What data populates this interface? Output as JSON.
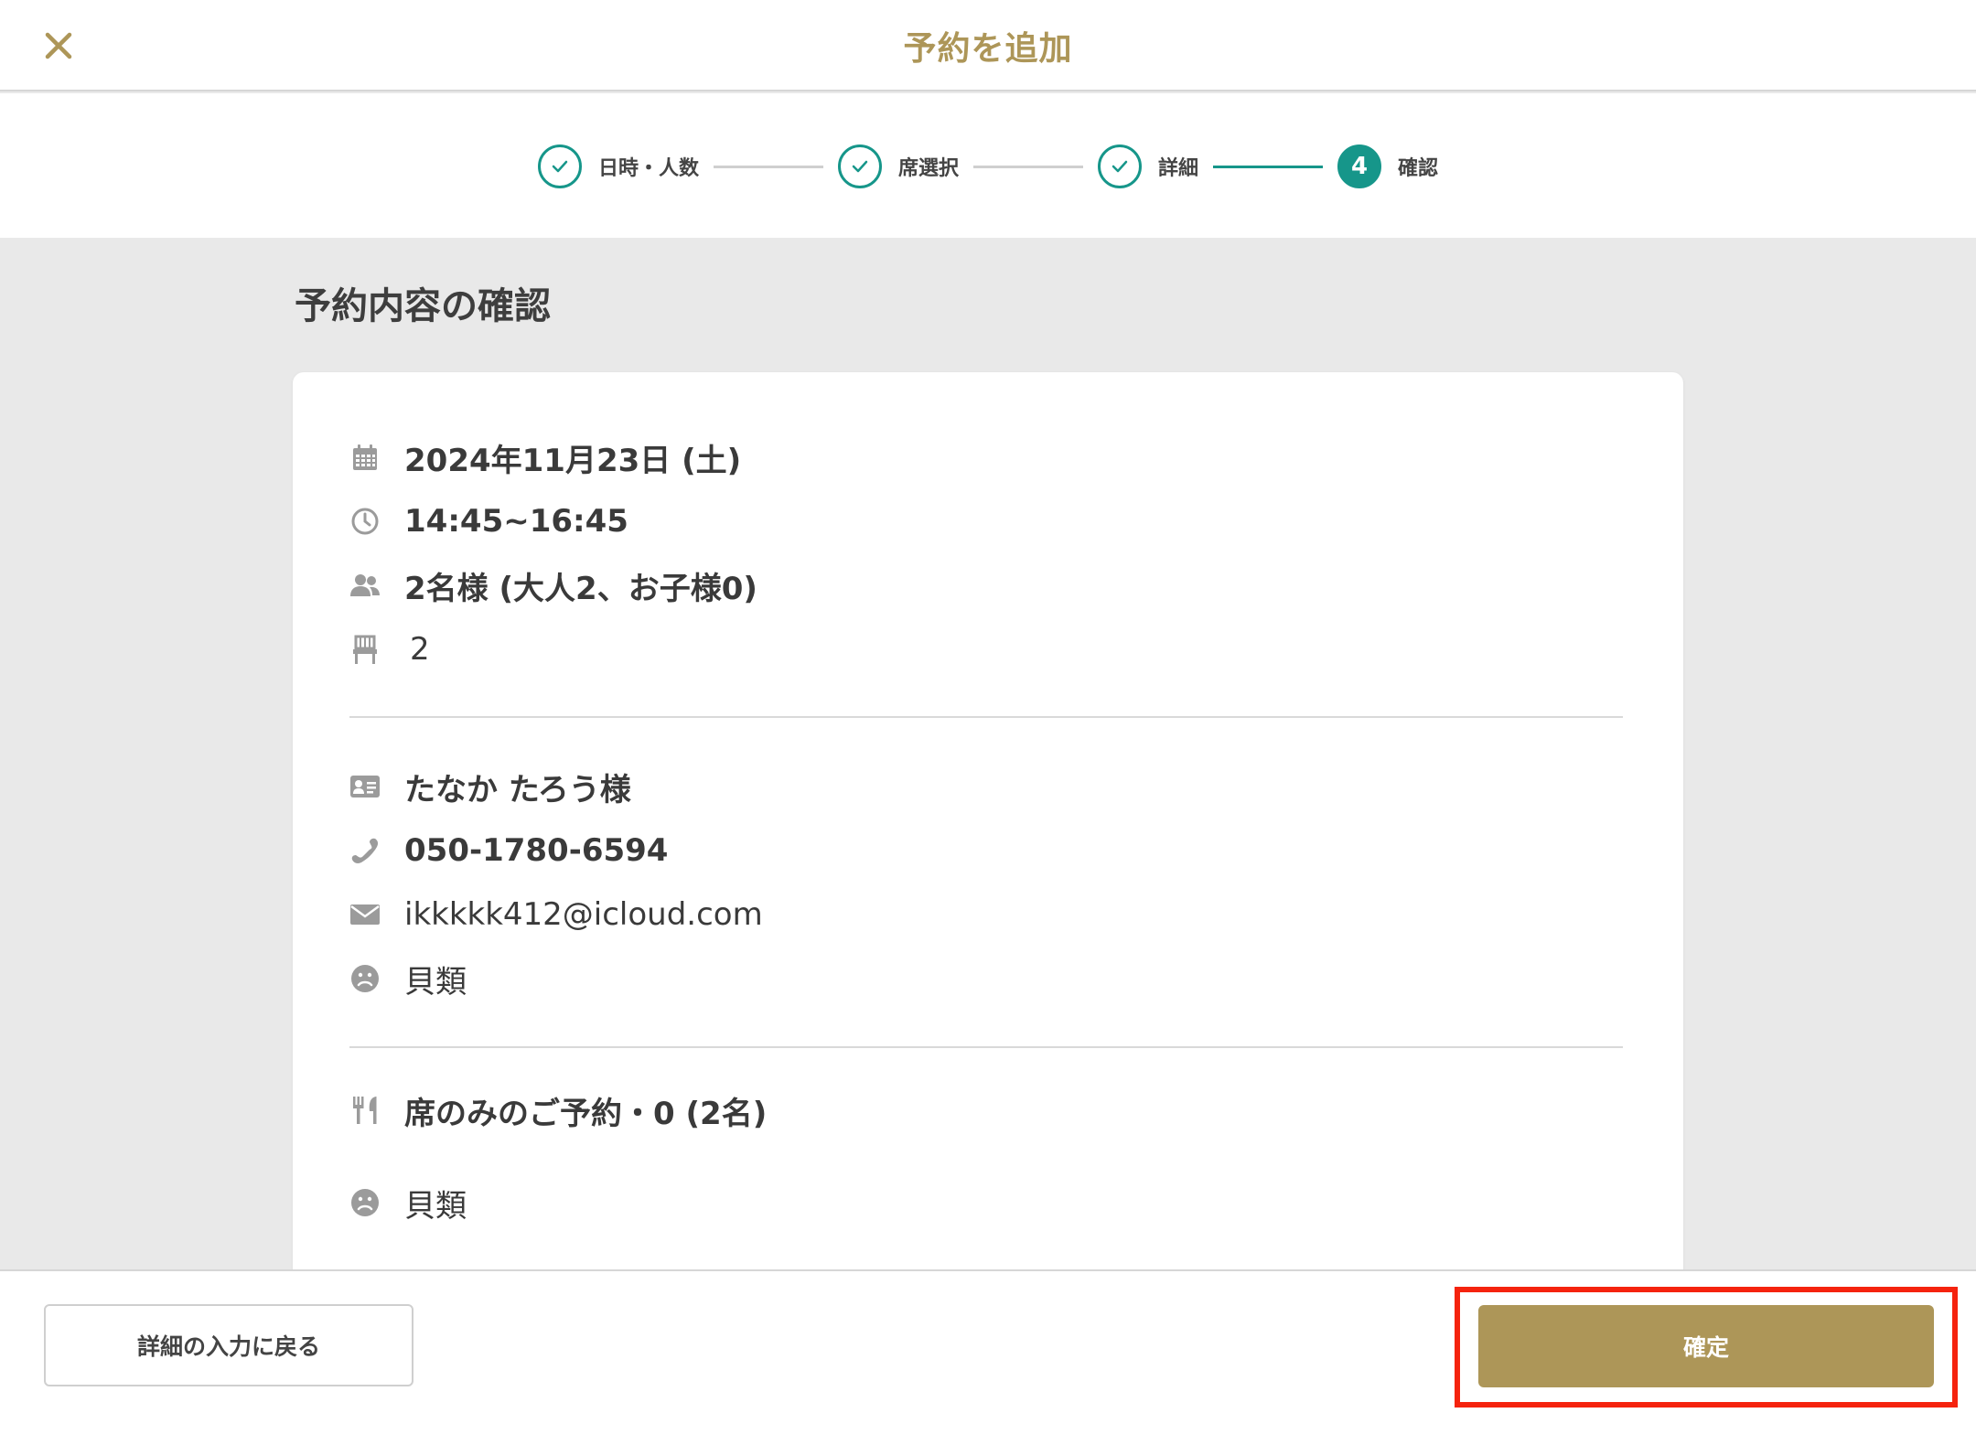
{
  "header": {
    "title": "予約を追加"
  },
  "stepper": {
    "steps": [
      {
        "label": "日時・人数",
        "state": "done"
      },
      {
        "label": "席選択",
        "state": "done"
      },
      {
        "label": "詳細",
        "state": "done"
      },
      {
        "label": "確認",
        "number": "4",
        "state": "active"
      }
    ]
  },
  "section": {
    "title": "予約内容の確認"
  },
  "reservation": {
    "date": "2024年11月23日 (土)",
    "time": "14:45~16:45",
    "guests": "2名様 (大人2、お子様0)",
    "seat": "2"
  },
  "customer": {
    "name": "たなか たろう様",
    "phone": "050-1780-6594",
    "email": "ikkkkk412@icloud.com",
    "allergy": "貝類"
  },
  "course": {
    "name": "席のみのご予約・0 (2名)",
    "allergy": "貝類"
  },
  "footer": {
    "back_label": "詳細の入力に戻る",
    "confirm_label": "確定"
  },
  "colors": {
    "brand": "#ad9658",
    "teal": "#16968a",
    "highlight": "#f5230e"
  }
}
